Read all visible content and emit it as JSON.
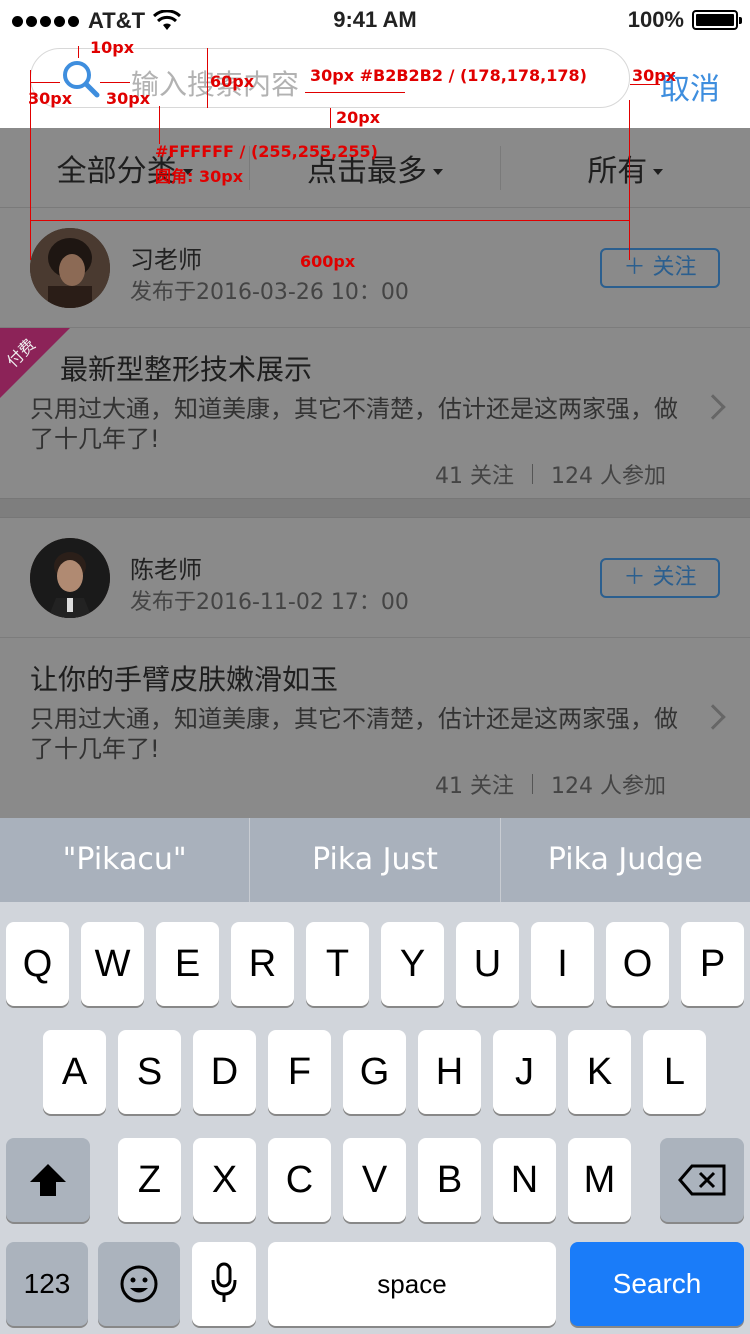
{
  "status_bar": {
    "carrier": "AT&T",
    "time": "9:41 AM",
    "battery": "100%"
  },
  "search": {
    "placeholder": "输入搜索内容",
    "cancel_label": "取消"
  },
  "filters": [
    "全部分类",
    "点击最多",
    "所有"
  ],
  "posts": [
    {
      "author": "习老师",
      "date": "发布于2016-03-26  10：00",
      "follow_label": "＋ 关注",
      "paid_badge": "付费",
      "title": "最新型整形技术展示",
      "desc": "只用过大通，知道美康，其它不清楚，估计还是这两家强，做了十几年了!",
      "follows": "41 关注",
      "participants": "124 人参加"
    },
    {
      "author": "陈老师",
      "date": "发布于2016-11-02  17：00",
      "follow_label": "＋ 关注",
      "paid_badge": "",
      "title": "让你的手臂皮肤嫩滑如玉",
      "desc": "只用过大通，知道美康，其它不清楚，估计还是这两家强，做了十几年了!",
      "follows": "41 关注",
      "participants": "124 人参加"
    }
  ],
  "annotations": {
    "a1": "10px",
    "a2": "30px",
    "a3": "30px",
    "a4": "60px",
    "a5": "30px #B2B2B2 / (178,178,178)",
    "a6": "30px",
    "a7": "20px",
    "a8": "#FFFFFF / (255,255,255)",
    "a9": "圆角: 30px",
    "a10": "600px"
  },
  "keyboard": {
    "suggestions": [
      "\"Pikacu\"",
      "Pika Just",
      "Pika Judge"
    ],
    "row1": [
      "Q",
      "W",
      "E",
      "R",
      "T",
      "Y",
      "U",
      "I",
      "O",
      "P"
    ],
    "row2": [
      "A",
      "S",
      "D",
      "F",
      "G",
      "H",
      "J",
      "K",
      "L"
    ],
    "row3": [
      "Z",
      "X",
      "C",
      "V",
      "B",
      "N",
      "M"
    ],
    "numbers_label": "123",
    "space_label": "space",
    "search_label": "Search"
  }
}
